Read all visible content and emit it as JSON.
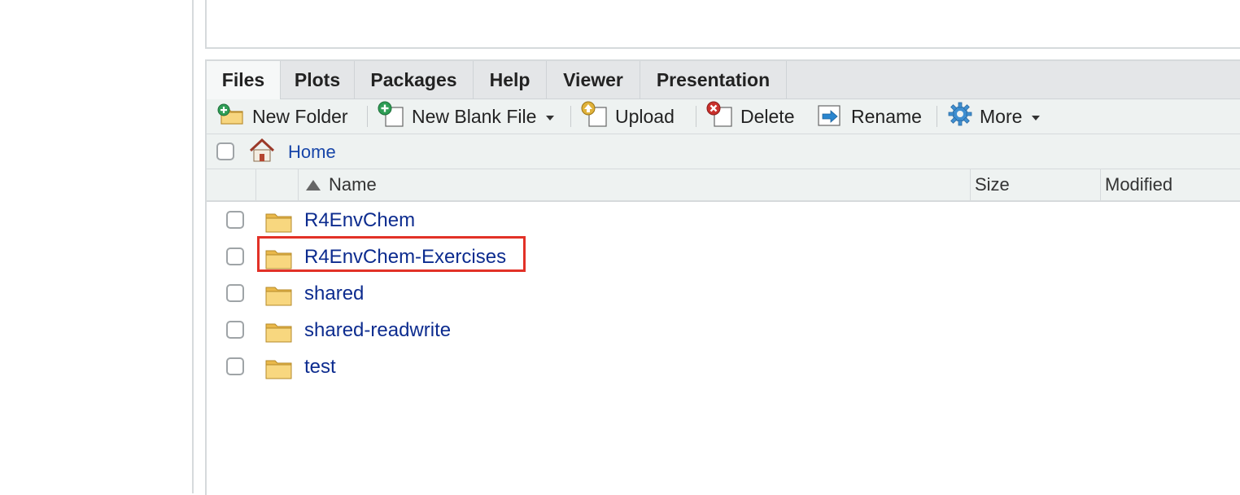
{
  "tabs": [
    "Files",
    "Plots",
    "Packages",
    "Help",
    "Viewer",
    "Presentation"
  ],
  "active_tab": "Files",
  "toolbar": {
    "new_folder": "New Folder",
    "new_blank_file": "New Blank File",
    "upload": "Upload",
    "delete": "Delete",
    "rename": "Rename",
    "more": "More"
  },
  "breadcrumb": {
    "home": "Home"
  },
  "columns": {
    "name": "Name",
    "size": "Size",
    "modified": "Modified"
  },
  "files": [
    {
      "name": "R4EnvChem",
      "type": "folder",
      "highlighted": false
    },
    {
      "name": "R4EnvChem-Exercises",
      "type": "folder",
      "highlighted": true
    },
    {
      "name": "shared",
      "type": "folder",
      "highlighted": false
    },
    {
      "name": "shared-readwrite",
      "type": "folder",
      "highlighted": false
    },
    {
      "name": "test",
      "type": "folder",
      "highlighted": false
    }
  ],
  "colors": {
    "highlight_border": "#e23127",
    "link": "#0d2c8f",
    "home_link": "#1745a8",
    "toolbar_bg": "#eef2f1",
    "tabbar_bg": "#e4e6e8"
  }
}
